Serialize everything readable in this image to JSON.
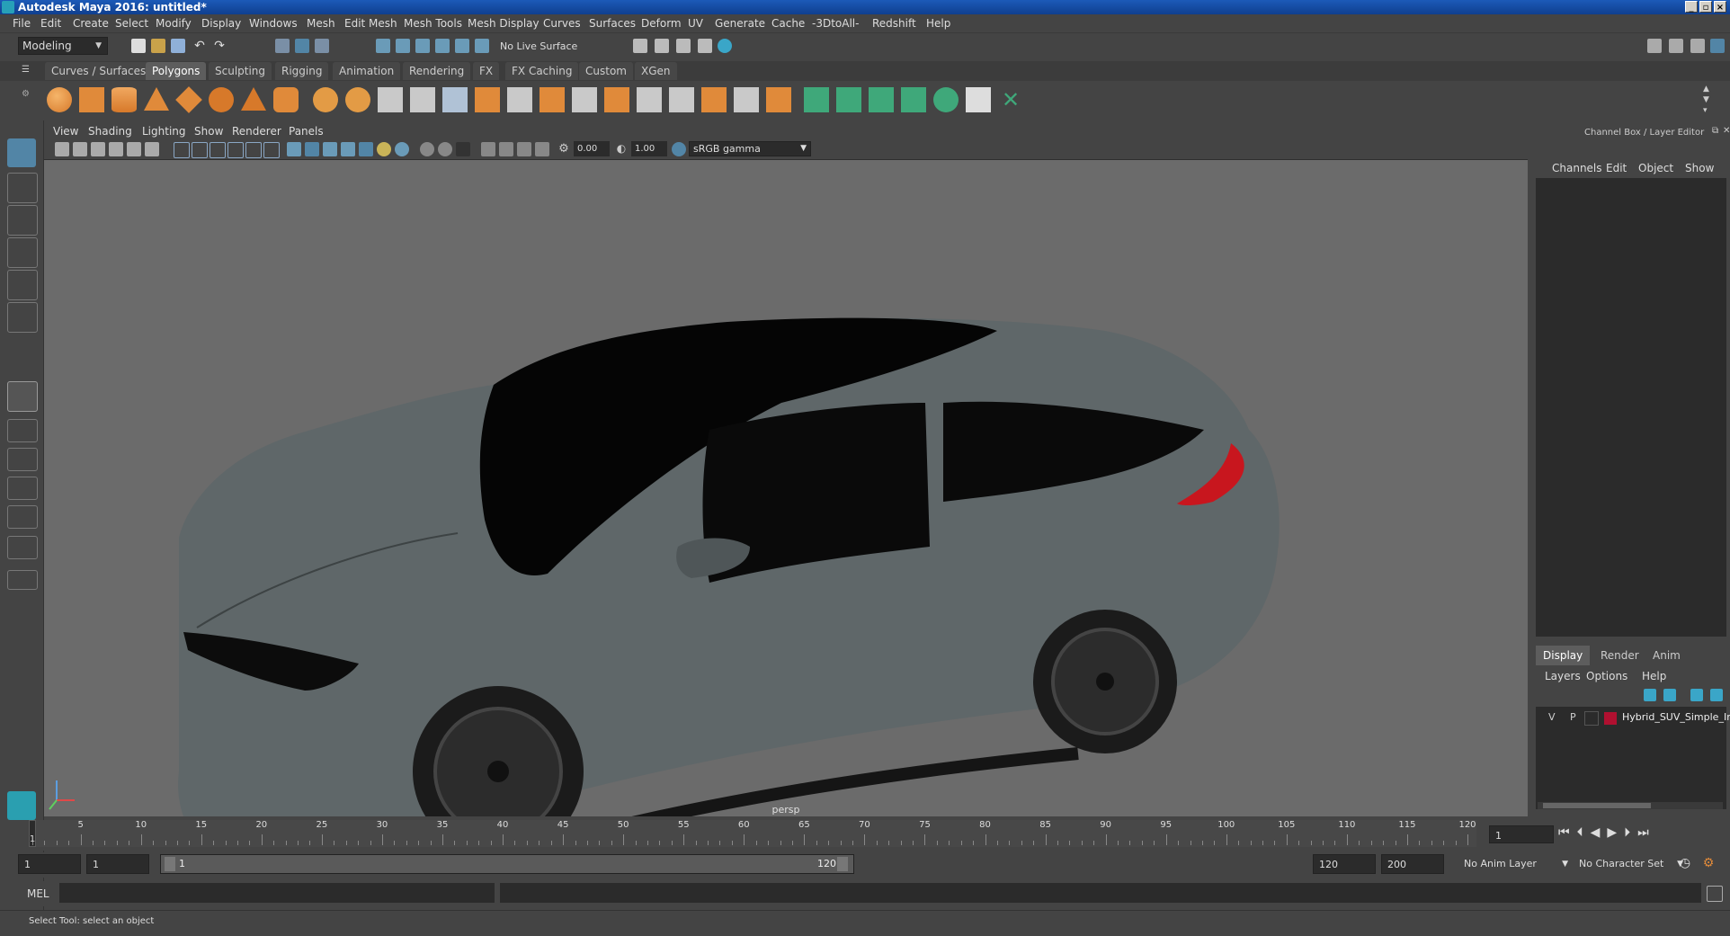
{
  "window": {
    "title": "Autodesk Maya 2016: untitled*"
  },
  "menubar": [
    "File",
    "Edit",
    "Create",
    "Select",
    "Modify",
    "Display",
    "Windows",
    "Mesh",
    "Edit Mesh",
    "Mesh Tools",
    "Mesh Display",
    "Curves",
    "Surfaces",
    "Deform",
    "UV",
    "Generate",
    "Cache",
    "-3DtoAll-",
    "Redshift",
    "Help"
  ],
  "statusline": {
    "mode": "Modeling",
    "live_surface": "No Live Surface"
  },
  "shelf": {
    "tabs": [
      "Curves / Surfaces",
      "Polygons",
      "Sculpting",
      "Rigging",
      "Animation",
      "Rendering",
      "FX",
      "FX Caching",
      "Custom",
      "XGen"
    ],
    "active": "Polygons"
  },
  "panel": {
    "menus": [
      "View",
      "Shading",
      "Lighting",
      "Show",
      "Renderer",
      "Panels"
    ],
    "exposure": "0.00",
    "gamma": "1.00",
    "color_space": "sRGB gamma",
    "camera": "persp"
  },
  "channel_box": {
    "title": "Channel Box / Layer Editor",
    "menus": [
      "Channels",
      "Edit",
      "Object",
      "Show"
    ]
  },
  "layer_editor": {
    "tabs": [
      "Display",
      "Render",
      "Anim"
    ],
    "active": "Display",
    "menus": [
      "Layers",
      "Options",
      "Help"
    ],
    "layers": [
      {
        "v": "V",
        "p": "P",
        "name": "Hybrid_SUV_Simple_In",
        "color": "#b01030"
      }
    ]
  },
  "timeline": {
    "ticks": [
      "1",
      "5",
      "10",
      "15",
      "20",
      "25",
      "30",
      "35",
      "40",
      "45",
      "50",
      "55",
      "60",
      "65",
      "70",
      "75",
      "80",
      "85",
      "90",
      "95",
      "100",
      "105",
      "110",
      "115",
      "120"
    ],
    "current_frame": "1"
  },
  "range": {
    "start": "1",
    "playback_start": "1",
    "slider_start": "1",
    "slider_end": "120",
    "playback_end": "120",
    "end": "200",
    "anim_layer": "No Anim Layer",
    "character_set": "No Character Set"
  },
  "command": {
    "lang": "MEL"
  },
  "helpline": "Select Tool: select an object",
  "colors": {
    "accent": "#5285a6",
    "viewport_bg": "#6b6b6b",
    "car_body": "#5f6769",
    "tail_light": "#c8161e"
  }
}
